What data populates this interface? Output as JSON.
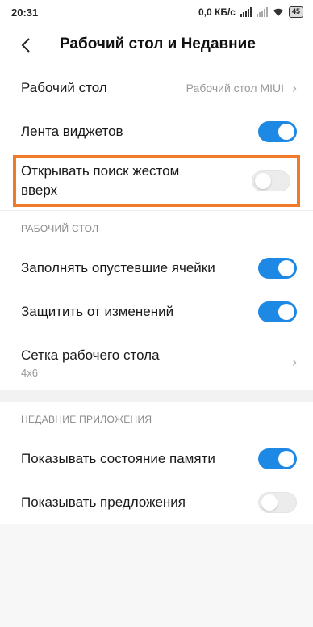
{
  "status_bar": {
    "time": "20:31",
    "network_speed": "0,0 КБ/с",
    "battery_level": "45"
  },
  "header": {
    "title": "Рабочий стол и Недавние"
  },
  "general": {
    "desktop": {
      "label": "Рабочий стол",
      "value": "Рабочий стол MIUI"
    },
    "widget_feed": {
      "label": "Лента виджетов",
      "enabled": true
    },
    "swipe_search": {
      "label_line1": "Открывать поиск жестом",
      "label_line2": "вверх",
      "enabled": false
    }
  },
  "desktop_section": {
    "header": "РАБОЧИЙ СТОЛ",
    "fill_cells": {
      "label": "Заполнять опустевшие ячейки",
      "enabled": true
    },
    "protect": {
      "label": "Защитить от изменений",
      "enabled": true
    },
    "grid": {
      "label": "Сетка рабочего стола",
      "value": "4x6"
    }
  },
  "recent_section": {
    "header": "НЕДАВНИЕ ПРИЛОЖЕНИЯ",
    "memory": {
      "label": "Показывать состояние памяти",
      "enabled": true
    },
    "suggestions": {
      "label": "Показывать предложения",
      "enabled": false
    }
  },
  "colors": {
    "accent": "#1e88e5",
    "highlight": "#f07a2a"
  }
}
